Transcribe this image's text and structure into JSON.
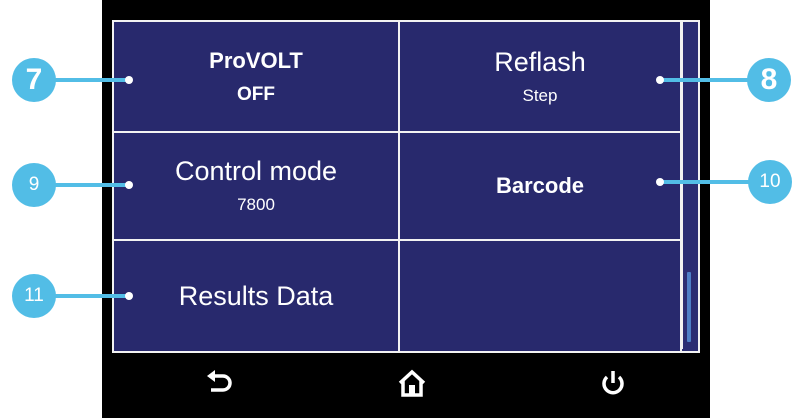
{
  "tiles": [
    {
      "title": "ProVOLT",
      "value": "OFF"
    },
    {
      "title": "Reflash",
      "value": "Step"
    },
    {
      "title": "Control mode",
      "value": "7800"
    },
    {
      "title": "Barcode",
      "value": ""
    },
    {
      "title": "Results Data",
      "value": ""
    },
    {
      "title": "",
      "value": ""
    }
  ],
  "callouts": [
    "7",
    "8",
    "9",
    "10",
    "11"
  ],
  "nav": {
    "back_icon": "back-arrow-icon",
    "home_icon": "home-icon",
    "power_icon": "power-icon"
  },
  "colors": {
    "panel_bg": "#28296d",
    "border": "#f2f2f2",
    "callout": "#52bde6",
    "scroll_thumb": "#4d7fc7"
  }
}
